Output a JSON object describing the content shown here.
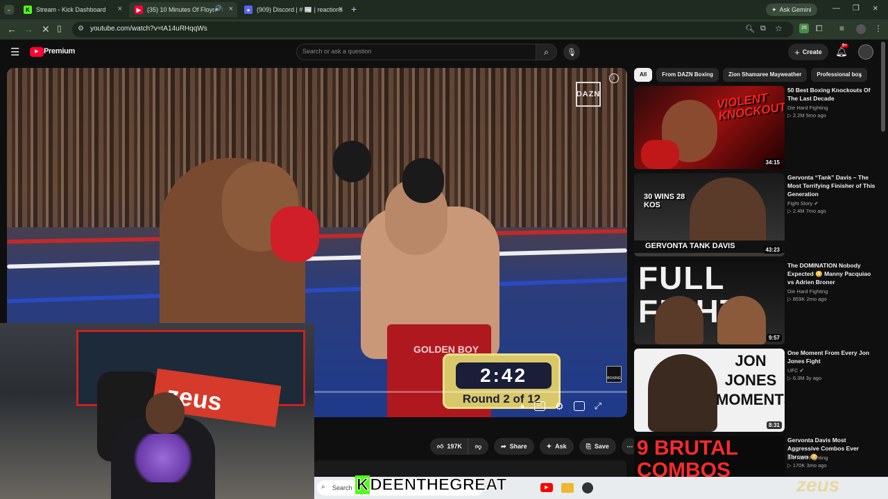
{
  "browser": {
    "tabs": [
      {
        "title": "Stream - Kick Dashboard",
        "active": false,
        "favicon": "kick-icon"
      },
      {
        "title": "(35) 10 Minutes Of Floyd M",
        "active": true,
        "favicon": "youtube-icon"
      },
      {
        "title": "(909) Discord | # 📰 | reactions",
        "active": false,
        "favicon": "discord-icon"
      }
    ],
    "new_tab": "+",
    "ask_gemini": "Ask Gemini",
    "url": "youtube.com/watch?v=tA14uRHqqWs",
    "extension_badge": "26"
  },
  "youtube": {
    "logo_text": "Premium",
    "search_placeholder": "Search or ask a question",
    "create_label": "Create",
    "notifications_badge": "9+"
  },
  "video": {
    "brand": "DAZN",
    "scoreboard_time": "2:42",
    "scoreboard_round": "Round 2 of 12",
    "corner_badge": "BOXING",
    "trunks_text": "GOLDEN BOY"
  },
  "actions": {
    "likes": "197K",
    "share": "Share",
    "ask": "Ask",
    "save": "Save"
  },
  "chips": [
    "All",
    "From DAZN Boxing",
    "Zion Shamaree Mayweather",
    "Professional box"
  ],
  "recommendations": [
    {
      "title": "50 Best Boxing Knockouts Of The Last Decade",
      "channel": "Die Hard Fighting",
      "meta": "2.2M  5mo ago",
      "duration": "34:15",
      "thumb_text": "VIOLENT KNOCKOUTS",
      "verified": false
    },
    {
      "title": "Gervonta “Tank” Davis – The Most Terrifying Finisher of This Generation",
      "channel": "Fight Story",
      "meta": "2.4M  7mo ago",
      "duration": "43:23",
      "thumb_text": "GERVONTA TANK DAVIS",
      "thumb_text2": "30 WINS 28 KOS",
      "verified": true
    },
    {
      "title": "The DOMINATION Nobody Expected 😳 Manny Pacquiao vs Adrien Broner",
      "channel": "Die Hard Fighting",
      "meta": "859K  2mo ago",
      "duration": "9:57",
      "thumb_text": "FULL FIGHT",
      "verified": false
    },
    {
      "title": "One Moment From Every Jon Jones Fight",
      "channel": "UFC",
      "meta": "6.3M  3y ago",
      "duration": "8:31",
      "thumb_text": "JON JONES MOMENTS",
      "verified": true
    },
    {
      "title": "Gervonta Davis Most Aggressive Combos Ever Thrown 😳",
      "channel": "Die Hard Fighting",
      "meta": "170K  3mo ago",
      "duration": "",
      "thumb_text": "9 BRUTAL COMBOS",
      "verified": false
    }
  ],
  "overlay": {
    "streamer_k": "K",
    "streamer_name": "DEENTHEGREAT",
    "taskbar_search": "Search",
    "sponsor": "zeus"
  }
}
